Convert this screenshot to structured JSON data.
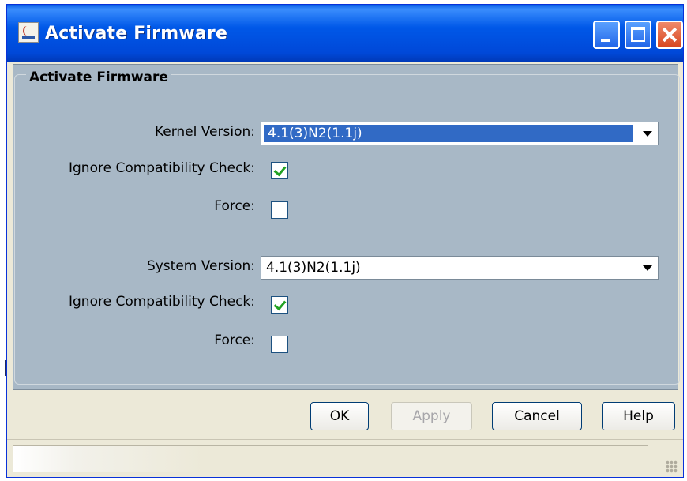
{
  "window": {
    "title": "Activate Firmware"
  },
  "panel": {
    "group_title": "Activate Firmware"
  },
  "kernel": {
    "label": "Kernel Version:",
    "value": "4.1(3)N2(1.1j)",
    "ignore_label": "Ignore Compatibility Check:",
    "ignore_checked": true,
    "force_label": "Force:",
    "force_checked": false
  },
  "system": {
    "label": "System Version:",
    "value": "4.1(3)N2(1.1j)",
    "ignore_label": "Ignore Compatibility Check:",
    "ignore_checked": true,
    "force_label": "Force:",
    "force_checked": false
  },
  "buttons": {
    "ok": "OK",
    "apply": "Apply",
    "cancel": "Cancel",
    "help": "Help"
  },
  "colors": {
    "titlebar": "#0054e3",
    "panel": "#a8b8c6",
    "selection": "#316ac5",
    "check": "#21a121"
  }
}
